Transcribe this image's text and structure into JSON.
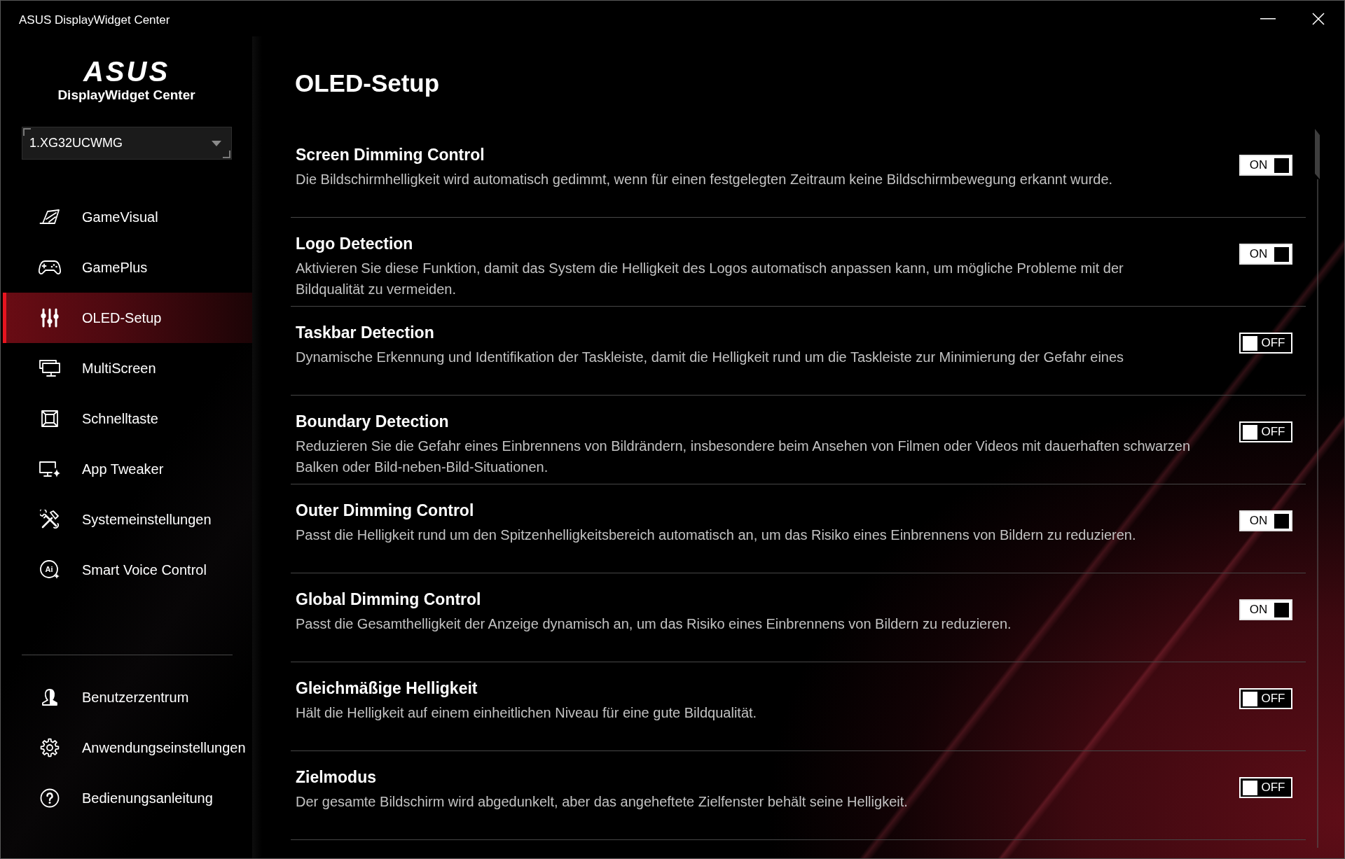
{
  "window": {
    "title": "ASUS DisplayWidget Center"
  },
  "sidebar": {
    "logo": "ASUS",
    "app_name": "DisplayWidget Center",
    "monitor_select": {
      "value": "1.XG32UCWMG"
    },
    "nav_items": [
      {
        "label": "GameVisual",
        "selected": false
      },
      {
        "label": "GamePlus",
        "selected": false
      },
      {
        "label": "OLED-Setup",
        "selected": true
      },
      {
        "label": "MultiScreen",
        "selected": false
      },
      {
        "label": "Schnelltaste",
        "selected": false
      },
      {
        "label": "App Tweaker",
        "selected": false
      },
      {
        "label": "Systemeinstellungen",
        "selected": false
      },
      {
        "label": "Smart Voice Control",
        "selected": false,
        "icon_text": "Ai"
      }
    ],
    "bottom_items": [
      {
        "label": "Benutzerzentrum"
      },
      {
        "label": "Anwendungseinstellungen"
      },
      {
        "label": "Bedienungsanleitung"
      }
    ]
  },
  "page": {
    "title": "OLED-Setup",
    "settings": [
      {
        "title": "Screen Dimming Control",
        "description": "Die Bildschirmhelligkeit wird automatisch gedimmt, wenn für einen festgelegten Zeitraum keine Bildschirmbewegung erkannt wurde.",
        "on": true,
        "toggle_label": "ON"
      },
      {
        "title": "Logo Detection",
        "description": "Aktivieren Sie diese Funktion, damit das System die Helligkeit des Logos automatisch anpassen kann, um mögliche Probleme mit der Bildqualität zu vermeiden.",
        "on": true,
        "toggle_label": "ON"
      },
      {
        "title": "Taskbar Detection",
        "description": "Dynamische Erkennung und Identifikation der Taskleiste, damit die Helligkeit rund um die Taskleiste zur Minimierung der Gefahr eines",
        "on": false,
        "toggle_label": "OFF"
      },
      {
        "title": "Boundary Detection",
        "description": "Reduzieren Sie die Gefahr eines Einbrennens von Bildrändern, insbesondere beim Ansehen von Filmen oder Videos mit dauerhaften schwarzen Balken oder Bild-neben-Bild-Situationen.",
        "on": false,
        "toggle_label": "OFF"
      },
      {
        "title": "Outer Dimming Control",
        "description": "Passt die Helligkeit rund um den Spitzenhelligkeitsbereich automatisch an, um das Risiko eines Einbrennens von Bildern zu reduzieren.",
        "on": true,
        "toggle_label": "ON"
      },
      {
        "title": "Global Dimming Control",
        "description": "Passt die Gesamthelligkeit der Anzeige dynamisch an, um das Risiko eines Einbrennens von Bildern zu reduzieren.",
        "on": true,
        "toggle_label": "ON"
      },
      {
        "title": "Gleichmäßige Helligkeit",
        "description": "Hält die Helligkeit auf einem einheitlichen Niveau für eine gute Bildqualität.",
        "on": false,
        "toggle_label": "OFF"
      },
      {
        "title": "Zielmodus",
        "description": "Der gesamte Bildschirm wird abgedunkelt, aber das angeheftete Zielfenster behält seine Helligkeit.",
        "on": false,
        "toggle_label": "OFF"
      }
    ]
  }
}
